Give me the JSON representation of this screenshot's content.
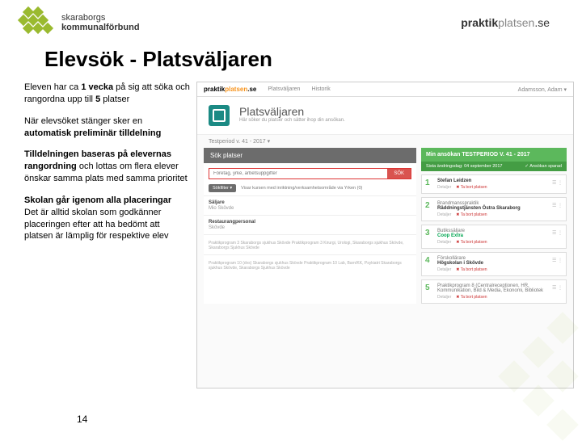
{
  "header": {
    "logo_left_line1": "skaraborgs",
    "logo_left_line2": "kommunalförbund",
    "logo_right_pre": "praktik",
    "logo_right_mid": "platsen",
    "logo_right_suf": ".se"
  },
  "title": "Elevsök - Platsväljaren",
  "bullets": {
    "p1a": "Eleven har ca ",
    "p1b": "1 vecka",
    "p1c": " på sig att söka och rangordna upp till ",
    "p1d": "5",
    "p1e": " platser",
    "p2a": "När elevsöket stänger sker en ",
    "p2b": "automatisk preliminär tilldelning",
    "p3a": "Tilldelningen baseras på elevernas rangordning",
    "p3b": " och lottas om flera elever önskar samma plats med samma prioritet",
    "p4a": "Skolan går igenom alla placeringar",
    "p4b": "Det är alltid skolan som godkänner placeringen efter att ha bedömt att platsen är lämplig för respektive elev"
  },
  "ss": {
    "brand_pre": "praktik",
    "brand_mid": "platsen",
    "brand_suf": ".se",
    "nav1": "Platsväljaren",
    "nav2": "Historik",
    "user": "Adamsson, Adam ▾",
    "hero_title": "Platsväljaren",
    "hero_sub": "Här söker du platser och sätter ihop din ansökan.",
    "period": "Testperiod v. 41 - 2017 ▾",
    "search_head": "Sök platser",
    "search_placeholder": "Företag, yrke, arbetsuppgifter",
    "search_btn": "SÖK",
    "filter_btn": "Sökfilter ▾",
    "filter_text": "Visar kursen med inriktning/verksamhetsområde via Yrken (0)",
    "results": [
      {
        "title": "Säljare",
        "sub": "Mio Skövde",
        "desc": ""
      },
      {
        "title": "Restaurangpersonal",
        "sub": "Skövde",
        "desc": ""
      },
      {
        "title": "",
        "sub": "",
        "desc": "Praktikprogram 3 Skaraborgs sjukhus Skövde\nPraktikprogram 3 Kirurgi, Urologi, Skaraborgs sjukhus Skövde, Skaraborgs Sjukhus Skövde"
      },
      {
        "title": "",
        "sub": "",
        "desc": "Praktikprogram 10 (dvs) Skaraborgs sjukhus Skövde\nPraktikprogram 10 Lab, Barn/KK, Psykiatri Skaraborgs sjukhus Skövde, Skaraborgs Sjukhus Skövde"
      }
    ],
    "app_head": "Min ansökan TESTPERIOD V. 41 - 2017",
    "app_sub_left": "Sista ändringsdag: 04 september 2017",
    "app_sub_right": "✓ Ansökan sparad",
    "app_items": [
      {
        "n": "1",
        "role": "",
        "company": "Stefan Leidzen"
      },
      {
        "n": "2",
        "role": "Brandmansspraktik",
        "company": "Räddningstjänsten Östra Skaraborg"
      },
      {
        "n": "3",
        "role": "Butikssäljare",
        "company": "Coop Extra",
        "coop": true
      },
      {
        "n": "4",
        "role": "Förskollärare",
        "company": "Högskolan i Skövde"
      },
      {
        "n": "5",
        "role": "Praktikprogram 8 (Centralreceptionen, HR, Kommunikation, Bild & Media, Ekonomi, Bibliotek",
        "company": ""
      }
    ],
    "link_detail": "Detaljer",
    "link_remove": "✖ Ta bort platsen"
  },
  "page_num": "14"
}
